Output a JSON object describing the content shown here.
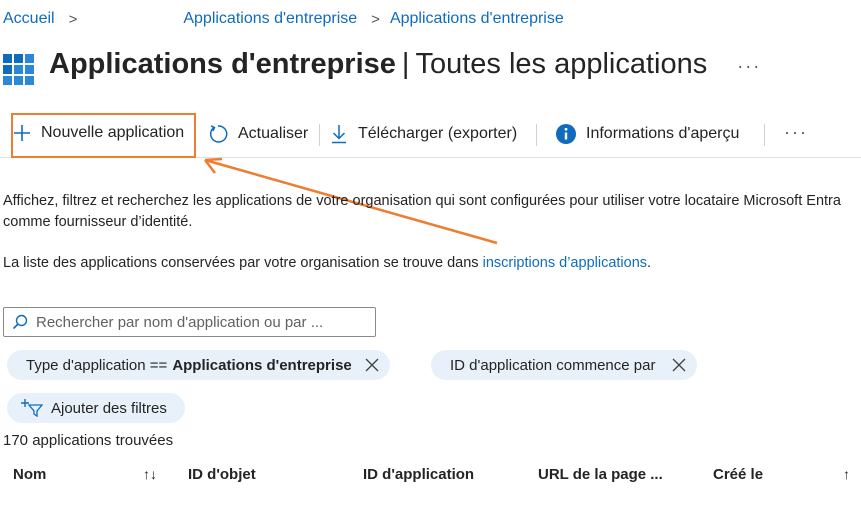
{
  "breadcrumb": {
    "home": "Accueil",
    "level1": "Applications d'entreprise",
    "level2": "Applications d'entreprise"
  },
  "header": {
    "title_bold": "Applications d'entreprise",
    "separator": "|",
    "title_sub": "Toutes les applications",
    "more": "···"
  },
  "toolbar": {
    "new_app": "Nouvelle application",
    "refresh": "Actualiser",
    "download": "Télécharger (exporter)",
    "preview_info": "Informations d'aperçu",
    "more": "···"
  },
  "description": {
    "text": "Affichez, filtrez et recherchez les applications de votre organisation qui sont configurées pour utiliser votre locataire Microsoft Entra comme fournisseur d’identité.",
    "list_text": "La liste des applications conservées par votre organisation se trouve dans ",
    "list_link": "inscriptions d’applications",
    "list_end": "."
  },
  "search": {
    "placeholder": "Rechercher par nom d'application ou par ..."
  },
  "filters": [
    {
      "label": "Type d'application ==",
      "value": "Applications d'entreprise"
    },
    {
      "label": "ID d'application commence par",
      "value": ""
    }
  ],
  "add_filter": "Ajouter des filtres",
  "result_count": "170 applications trouvées",
  "table": {
    "columns": [
      "Nom",
      "ID d'objet",
      "ID d'application",
      "URL de la page ...",
      "Créé le"
    ]
  },
  "colors": {
    "accent": "#0f6cbd",
    "highlight": "#ed7d31",
    "pill_bg": "#e8f1fa"
  }
}
